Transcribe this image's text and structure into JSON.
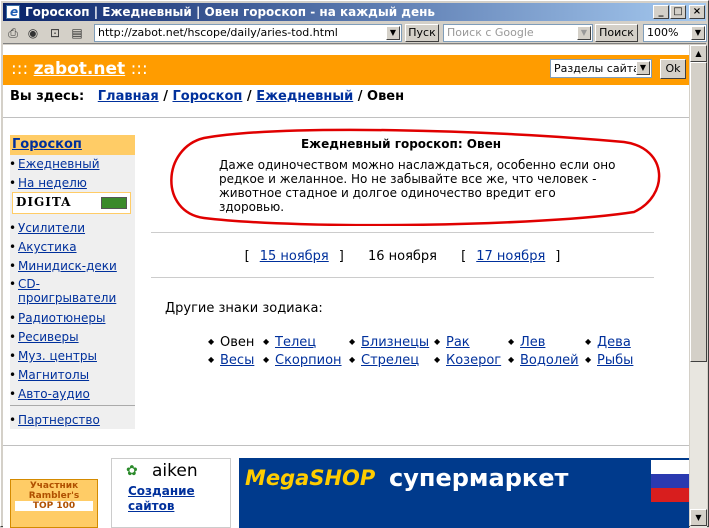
{
  "window": {
    "title": "Гороскоп | Ежедневный | Овен гороскоп - на каждый день",
    "btn_min": "_",
    "btn_max": "□",
    "btn_close": "×"
  },
  "toolbar": {
    "address": "http://zabot.net/hscope/daily/aries-tod.html",
    "go_label": "Пуск",
    "search_placeholder": "Поиск с Google",
    "search_label": "Поиск",
    "zoom": "100%"
  },
  "header": {
    "logo_prefix": ":::",
    "logo_name": "zabot.net",
    "logo_suffix": ":::",
    "sections_label": "Разделы сайта:",
    "ok_label": "Ok"
  },
  "breadcrumb": {
    "prefix": "Вы здесь:",
    "items": [
      "Главная",
      "Гороскоп",
      "Ежедневный"
    ],
    "separator": "/",
    "current": "Овен"
  },
  "sidebar": {
    "title": "Гороскоп",
    "items": [
      "Ежедневный",
      "На неделю"
    ],
    "banner": "DIGITA",
    "shop_items": [
      "Усилители",
      "Акустика",
      "Минидиск-деки",
      "CD-проигрыватели",
      "Радиотюнеры",
      "Ресиверы",
      "Муз. центры",
      "Магнитолы",
      "Авто-аудио"
    ],
    "partner": "Партнерство"
  },
  "horoscope": {
    "title": "Ежедневный гороскоп: Овен",
    "text": "Даже одиночеством можно наслаждаться, особенно если оно редкое и желанное. Но не забывайте все же, что человек - животное стадное и долгое одиночество вредит его здоровью."
  },
  "dates": {
    "prev": "15 ноября",
    "current": "16 ноября",
    "next": "17 ноября"
  },
  "zodiac": {
    "label": "Другие знаки зодиака:",
    "signs": [
      "Овен",
      "Телец",
      "Близнецы",
      "Рак",
      "Лев",
      "Дева",
      "Весы",
      "Скорпион",
      "Стрелец",
      "Козерог",
      "Водолей",
      "Рыбы"
    ]
  },
  "footer": {
    "rambler_line1": "Участник",
    "rambler_line2": "Rambler's",
    "rambler_line3": "TOP 100",
    "aiken_logo": "aiken",
    "aiken_link1": "Создание",
    "aiken_link2": "сайтов",
    "banner_brand": "MegaSHOP",
    "banner_text": "супермаркет"
  },
  "colors": {
    "accent": "#ff9c00",
    "link": "#00309c",
    "annotation": "#e00000"
  }
}
